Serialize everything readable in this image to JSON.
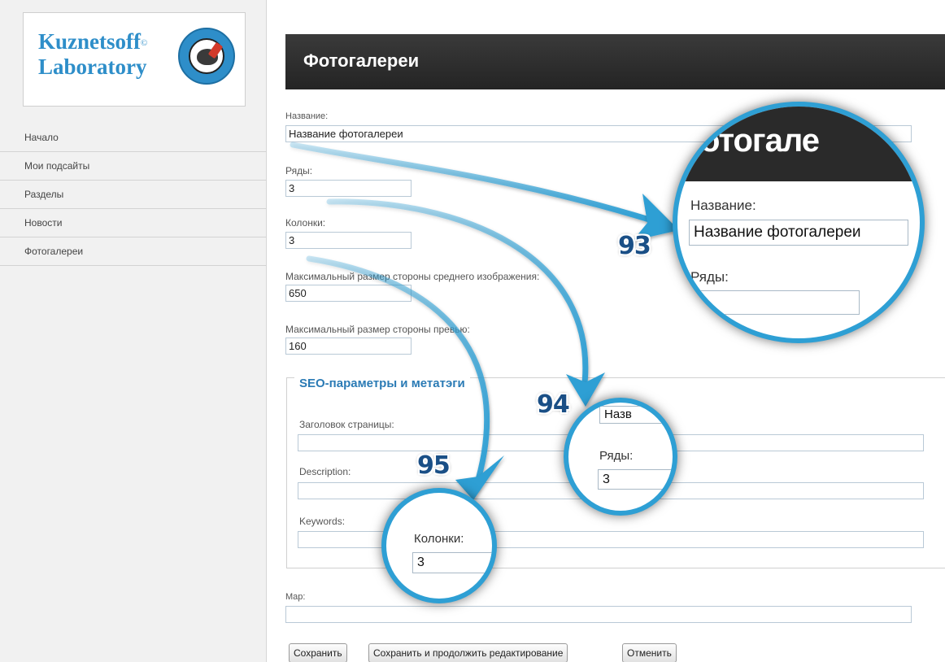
{
  "logo": {
    "line1": "Kuznetsoff",
    "line2": "Laboratory",
    "mark": "©"
  },
  "sidebar": {
    "items": [
      {
        "label": "Начало"
      },
      {
        "label": "Мои подсайты"
      },
      {
        "label": "Разделы"
      },
      {
        "label": "Новости"
      },
      {
        "label": "Фотогалереи"
      }
    ]
  },
  "page": {
    "title": "Фотогалереи"
  },
  "form": {
    "name_label": "Название:",
    "name_value": "Название фотогалереи",
    "rows_label": "Ряды:",
    "rows_value": "3",
    "cols_label": "Колонки:",
    "cols_value": "3",
    "medium_label": "Максимальный размер стороны среднего изображения:",
    "medium_value": "650",
    "preview_label": "Максимальный размер стороны превью:",
    "preview_value": "160",
    "seo": {
      "legend": "SEO-параметры и метатэги",
      "title_label": "Заголовок страницы:",
      "title_value": "",
      "description_label": "Description:",
      "description_value": "",
      "keywords_label": "Keywords:",
      "keywords_value": ""
    },
    "map_label": "Map:",
    "map_value": ""
  },
  "buttons": {
    "save": "Сохранить",
    "save_continue": "Сохранить и продолжить редактирование",
    "cancel": "Отменить"
  },
  "callouts": {
    "c93": "93",
    "c94": "94",
    "c95": "95",
    "zoom93": {
      "bar_text": "отогале",
      "name_label": "Название:",
      "name_value": "Название фотогалереи",
      "rows_label": "Ряды:",
      "rows_value": ""
    },
    "zoom94": {
      "top_value": "Назв",
      "rows_label": "Ряды:",
      "rows_value": "3"
    },
    "zoom95": {
      "cols_label": "Колонки:",
      "cols_value": "3"
    }
  },
  "colors": {
    "accent": "#2e9fd4",
    "callout_number": "#1a4f86",
    "header_bar": "#2a2a2a",
    "legend": "#2b7bb5"
  }
}
